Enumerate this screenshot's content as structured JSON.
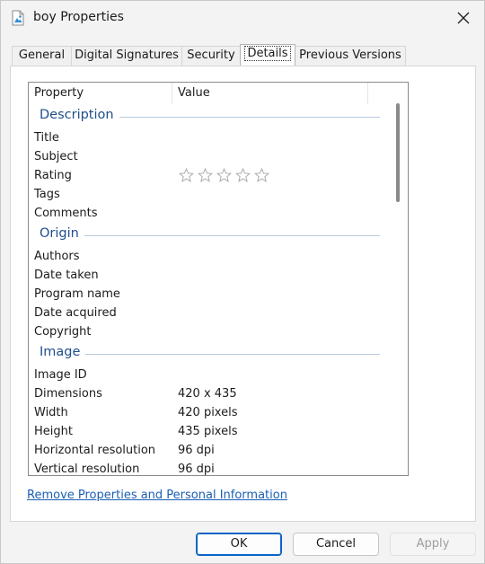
{
  "window": {
    "title": "boy Properties"
  },
  "tabs": [
    {
      "label": "General"
    },
    {
      "label": "Digital Signatures"
    },
    {
      "label": "Security"
    },
    {
      "label": "Details"
    },
    {
      "label": "Previous Versions"
    }
  ],
  "active_tab": "Details",
  "list": {
    "col_property": "Property",
    "col_value": "Value",
    "groups": [
      {
        "label": "Description",
        "props": [
          {
            "name": "Title",
            "value": ""
          },
          {
            "name": "Subject",
            "value": ""
          },
          {
            "name": "Rating",
            "value": "",
            "rating_stars": 0,
            "rating_max": 5
          },
          {
            "name": "Tags",
            "value": ""
          },
          {
            "name": "Comments",
            "value": ""
          }
        ]
      },
      {
        "label": "Origin",
        "props": [
          {
            "name": "Authors",
            "value": ""
          },
          {
            "name": "Date taken",
            "value": ""
          },
          {
            "name": "Program name",
            "value": ""
          },
          {
            "name": "Date acquired",
            "value": ""
          },
          {
            "name": "Copyright",
            "value": ""
          }
        ]
      },
      {
        "label": "Image",
        "props": [
          {
            "name": "Image ID",
            "value": ""
          },
          {
            "name": "Dimensions",
            "value": "420 x 435"
          },
          {
            "name": "Width",
            "value": "420 pixels"
          },
          {
            "name": "Height",
            "value": "435 pixels"
          },
          {
            "name": "Horizontal resolution",
            "value": "96 dpi"
          },
          {
            "name": "Vertical resolution",
            "value": "96 dpi"
          }
        ]
      }
    ]
  },
  "link_text": "Remove Properties and Personal Information",
  "buttons": {
    "ok": "OK",
    "cancel": "Cancel",
    "apply": "Apply"
  },
  "colors": {
    "accent": "#0a63c9",
    "group_label": "#1f4e8c",
    "link": "#1a5fb4"
  }
}
